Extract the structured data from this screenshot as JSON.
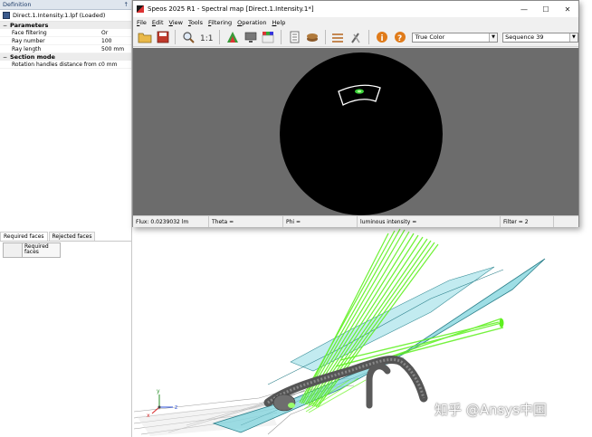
{
  "definition_panel": {
    "header": "Definition",
    "pin": "↑",
    "tree_item": "Direct.1.Intensity.1.lpf (Loaded)",
    "sections": [
      {
        "title": "Parameters",
        "rows": [
          {
            "name": "Face filtering",
            "value": "Or"
          },
          {
            "name": "Ray number",
            "value": "100"
          },
          {
            "name": "Ray length",
            "value": "500 mm"
          }
        ]
      },
      {
        "title": "Section mode",
        "rows": [
          {
            "name": "Rotation handles distance from center",
            "value": "0 mm"
          }
        ]
      }
    ],
    "tabs": [
      "Required faces",
      "Rejected faces"
    ],
    "faces_header": "Required faces"
  },
  "spectral_window": {
    "title": "Speos 2025 R1 - Spectral map [Direct.1.Intensity.1*]",
    "controls": {
      "minimize": "—",
      "maximize": "☐",
      "close": "✕"
    },
    "menu": [
      {
        "u": "F",
        "rest": "ile"
      },
      {
        "u": "E",
        "rest": "dit"
      },
      {
        "u": "V",
        "rest": "iew"
      },
      {
        "u": "T",
        "rest": "ools"
      },
      {
        "u": "F",
        "rest": "iltering"
      },
      {
        "u": "O",
        "rest": "peration"
      },
      {
        "u": "H",
        "rest": "elp"
      }
    ],
    "color_mode": "True Color",
    "sequence": "Sequence 39",
    "status": {
      "flux": "Flux: 0.0239032 lm",
      "theta": "Theta =",
      "phi": "Phi =",
      "intensity": "luminous intensity =",
      "filter": "Filter = 2"
    }
  },
  "axes": {
    "x": "x",
    "y": "y",
    "z": "z"
  },
  "watermark": "知乎 @Ansys中国",
  "colors": {
    "ray_green": "#5ef01e",
    "light_guide_cyan": "#7ed3dc",
    "map_background": "#6c6c6c",
    "map_disk": "#000000",
    "hot_spot": "#3cd23c"
  }
}
